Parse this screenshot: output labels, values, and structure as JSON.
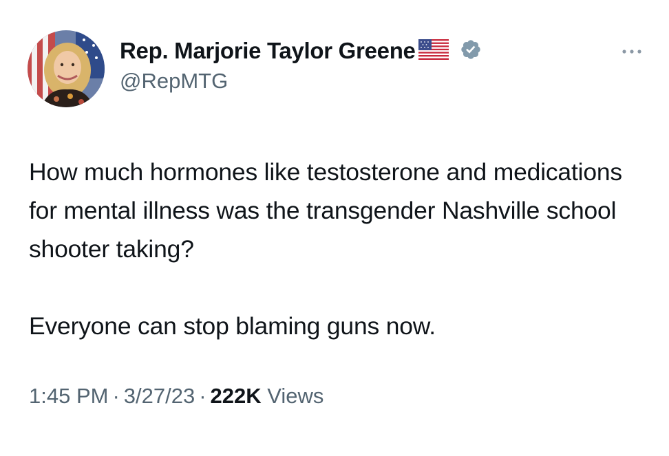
{
  "author": {
    "display_name": "Rep. Marjorie Taylor Greene",
    "handle": "@RepMTG",
    "badge": "flag-us-icon",
    "verified": "verified-badge-icon",
    "verified_color": "#829aab"
  },
  "tweet": {
    "paragraph_1": "How much hormones like testosterone and medications for mental illness was the transgender Nashville school shooter taking?",
    "paragraph_2": "Everyone can stop blaming guns now."
  },
  "meta": {
    "time": "1:45 PM",
    "separator": "·",
    "date": "3/27/23",
    "views_count": "222K",
    "views_label": "Views"
  },
  "icons": {
    "more": "more-options-icon"
  },
  "colors": {
    "text_primary": "#0f1419",
    "text_secondary": "#536471"
  }
}
